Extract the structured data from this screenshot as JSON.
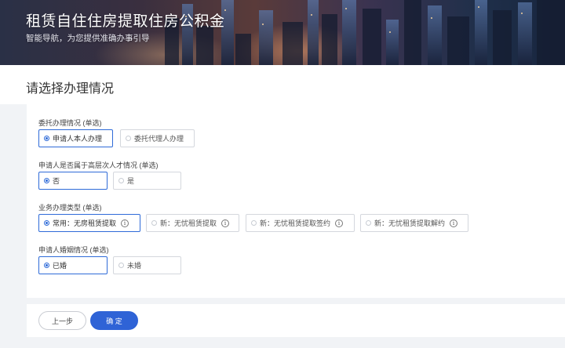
{
  "banner": {
    "title": "租赁自住住房提取住房公积金",
    "subtitle": "智能导航，为您提供准确办事引导"
  },
  "page": {
    "title": "请选择办理情况"
  },
  "sections": [
    {
      "label": "委托办理情况 (单选)",
      "options": [
        {
          "label": "申请人本人办理",
          "selected": true
        },
        {
          "label": "委托代理人办理",
          "selected": false
        }
      ]
    },
    {
      "label": "申请人是否属于高层次人才情况 (单选)",
      "options": [
        {
          "label": "否",
          "selected": true
        },
        {
          "label": "是",
          "selected": false
        }
      ]
    },
    {
      "label": "业务办理类型 (单选)",
      "options": [
        {
          "label": "常用：无房租赁提取",
          "selected": true,
          "info": "i"
        },
        {
          "label": "新：无忧租赁提取",
          "selected": false,
          "info": "i"
        },
        {
          "label": "新：无忧租赁提取签约",
          "selected": false,
          "info": "i"
        },
        {
          "label": "新：无忧租赁提取解约",
          "selected": false,
          "info": "i"
        }
      ]
    },
    {
      "label": "申请人婚姻情况 (单选)",
      "options": [
        {
          "label": "已婚",
          "selected": true
        },
        {
          "label": "未婚",
          "selected": false
        }
      ]
    }
  ],
  "footer": {
    "prev_label": "上一步",
    "confirm_label": "确 定"
  },
  "colors": {
    "accent": "#2f63d6",
    "selected_border": "#2f6bd8"
  }
}
